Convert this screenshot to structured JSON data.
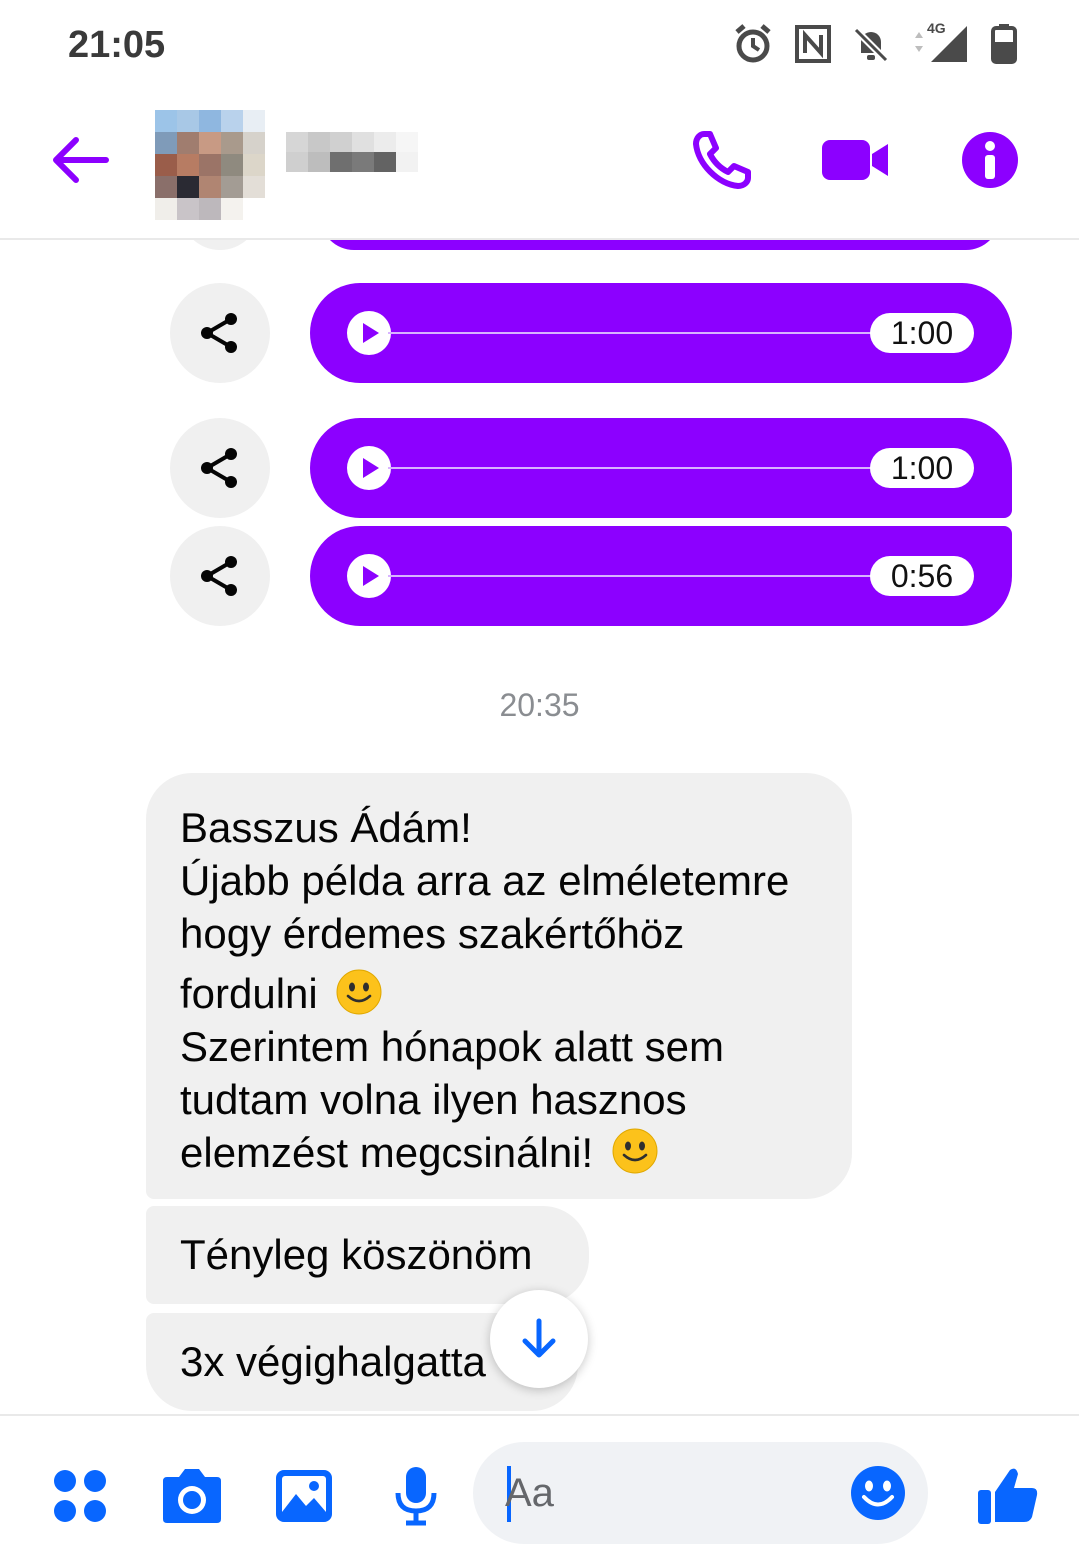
{
  "status_bar": {
    "time": "21:05",
    "network_label": "4G"
  },
  "header": {
    "back_icon": "arrow-left-icon",
    "call_icon": "phone-icon",
    "video_icon": "video-camera-icon",
    "info_icon": "info-icon"
  },
  "colors": {
    "accent": "#8c00ff",
    "messenger_blue": "#0866ff",
    "bubble_gray": "#f0f0f0"
  },
  "audio_messages": [
    {
      "duration": "1:00"
    },
    {
      "duration": "1:00"
    },
    {
      "duration": "0:56"
    }
  ],
  "timestamp": "20:35",
  "messages": {
    "msg1_lines": [
      "Basszus Ádám!",
      "Újabb példa arra az elméletemre",
      "hogy érdemes szakértőhöz",
      "fordulni",
      "Szerintem hónapok alatt sem",
      "tudtam volna ilyen hasznos",
      "elemzést megcsinálni!"
    ],
    "msg2": "Tényleg köszönöm",
    "msg3": "3x végighalgatta"
  },
  "composer": {
    "placeholder": "Aa"
  }
}
